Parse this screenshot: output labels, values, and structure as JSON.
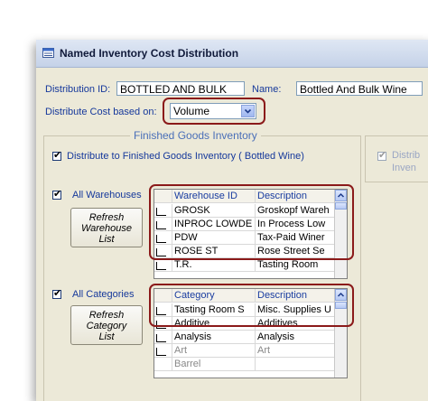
{
  "window": {
    "title": "Named Inventory Cost Distribution"
  },
  "header": {
    "distribution_id_label": "Distribution ID:",
    "distribution_id_value": "BOTTLED AND BULK",
    "name_label": "Name:",
    "name_value": "Bottled And Bulk Wine",
    "cost_basis_label": "Distribute Cost based on:",
    "cost_basis_value": "Volume"
  },
  "finished_goods": {
    "group_title": "Finished Goods Inventory",
    "distribute_label": "Distribute to Finished Goods Inventory ( Bottled Wine)",
    "distribute_checked": true
  },
  "right_group": {
    "line1": "Distrib",
    "line2": "Inven"
  },
  "warehouses": {
    "all_label": "All Warehouses",
    "all_checked": true,
    "refresh_label_1": "Refresh",
    "refresh_label_2": "Warehouse",
    "refresh_label_3": "List",
    "columns": [
      "Warehouse ID",
      "Description"
    ],
    "rows": [
      {
        "id": "GROSK",
        "description": "Groskopf Wareh",
        "selected": true
      },
      {
        "id": "INPROC LOWDE",
        "description": "In Process Low",
        "selected": true
      },
      {
        "id": "PDW",
        "description": "Tax-Paid Winer",
        "selected": true
      },
      {
        "id": "ROSE ST",
        "description": "Rose Street Se",
        "selected": true
      },
      {
        "id": "T.R.",
        "description": "Tasting Room",
        "selected": true
      }
    ]
  },
  "categories": {
    "all_label": "All Categories",
    "all_checked": true,
    "refresh_label_1": "Refresh",
    "refresh_label_2": "Category",
    "refresh_label_3": "List",
    "columns": [
      "Category",
      "Description"
    ],
    "rows": [
      {
        "id": "Tasting Room S",
        "description": "Misc. Supplies U",
        "selected": true
      },
      {
        "id": "Additive",
        "description": "Additives",
        "selected": true
      },
      {
        "id": "Analysis",
        "description": "Analysis",
        "selected": true
      },
      {
        "id": "Art",
        "description": "Art",
        "selected": true
      },
      {
        "id": "Barrel",
        "description": "",
        "selected": false
      }
    ]
  },
  "icons": {
    "window_icon": "form-icon",
    "dropdown": "chevron-down-icon",
    "scroll_up": "chevron-up-icon",
    "check": "check-icon"
  },
  "colors": {
    "callout": "#8b1a1a",
    "label": "#15389b",
    "group_title": "#4a6fb8"
  }
}
